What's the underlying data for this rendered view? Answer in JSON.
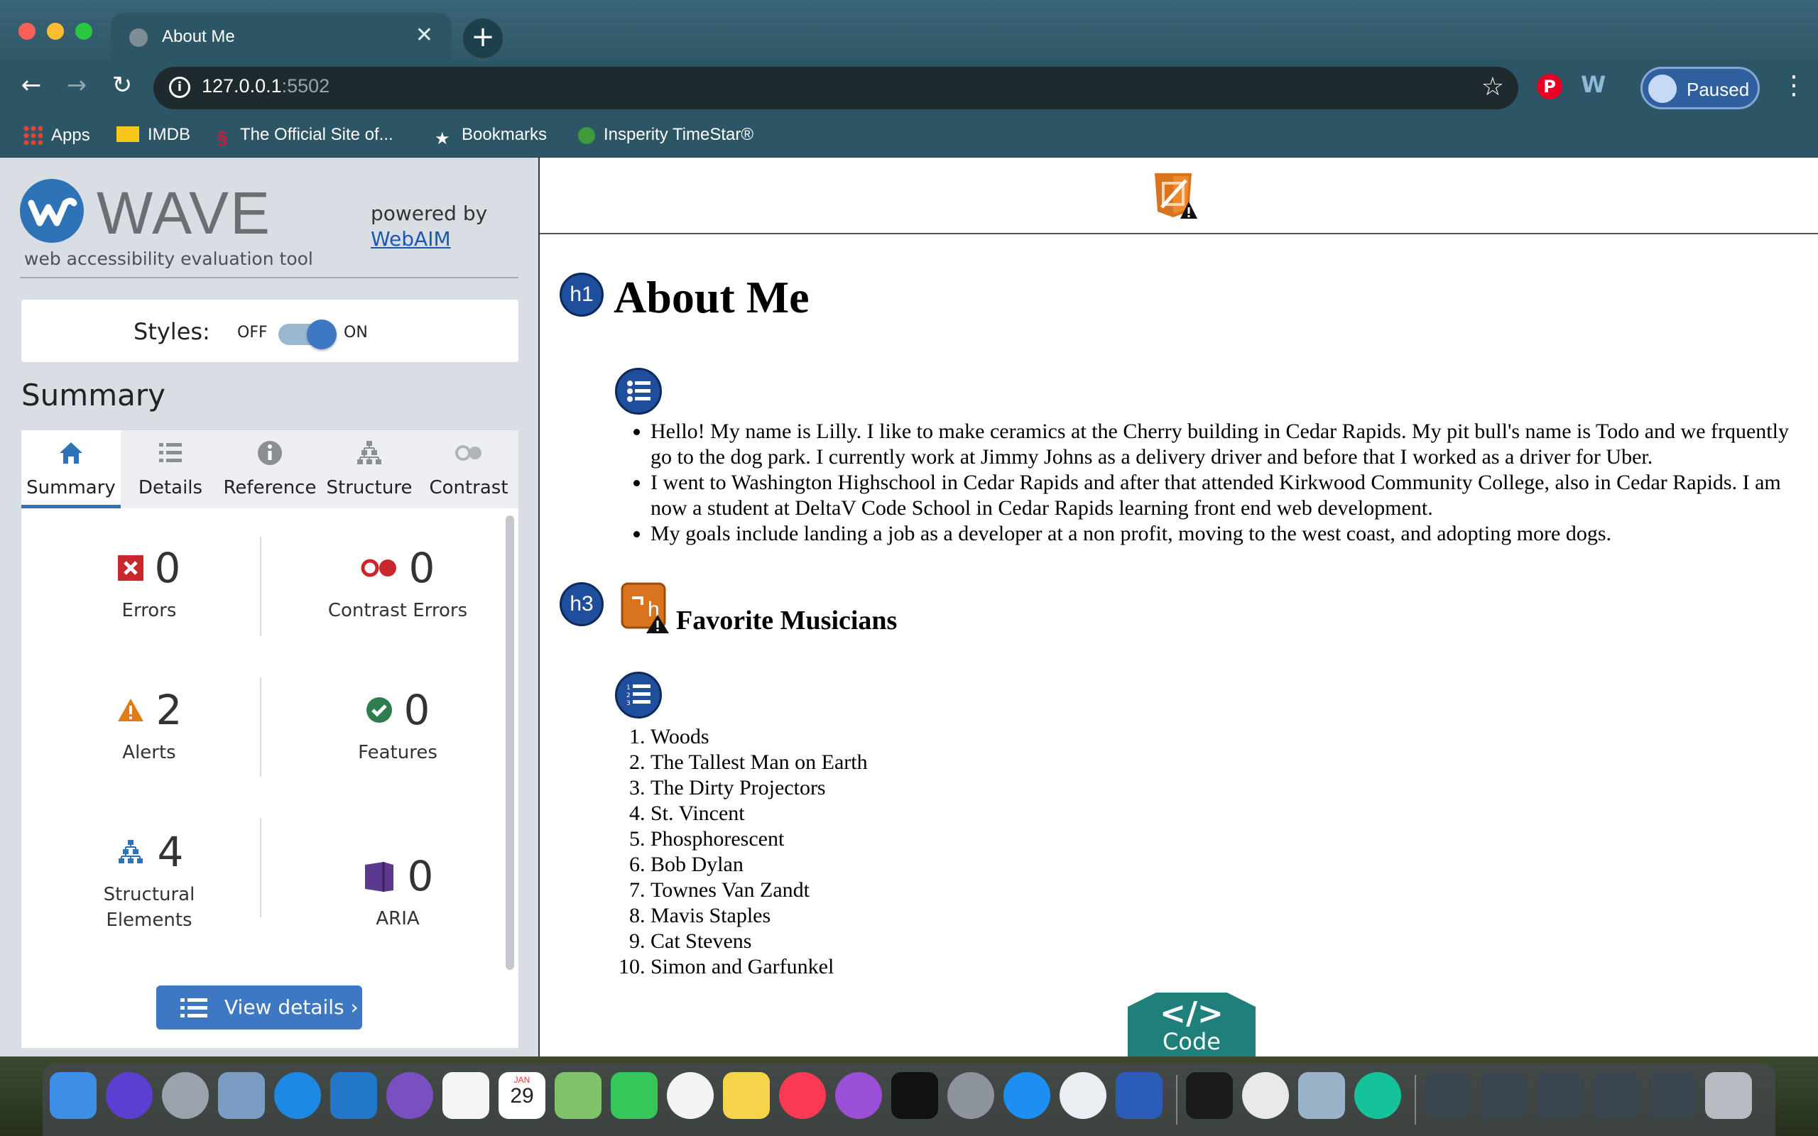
{
  "browser": {
    "tab_title": "About Me",
    "url_host": "127.0.0.1",
    "url_port": ":5502",
    "profile_label": "Paused",
    "bookmarks": [
      {
        "label": "Apps",
        "icon": "apps-grid-icon"
      },
      {
        "label": "IMDB",
        "icon": "imdb-icon"
      },
      {
        "label": "The Official Site of...",
        "icon": "cardinals-icon"
      },
      {
        "label": "Bookmarks",
        "icon": "star-icon"
      },
      {
        "label": "Insperity TimeStar®",
        "icon": "insperity-icon"
      }
    ]
  },
  "wave": {
    "logo_text": "WAVE",
    "subtitle": "web accessibility evaluation tool",
    "powered_by": "powered by",
    "webaim_link": "WebAIM",
    "styles_label": "Styles:",
    "styles_off": "OFF",
    "styles_on": "ON",
    "styles_enabled": true,
    "summary_heading": "Summary",
    "tabs": [
      {
        "label": "Summary",
        "icon": "home-icon",
        "active": true
      },
      {
        "label": "Details",
        "icon": "list-icon",
        "active": false
      },
      {
        "label": "Reference",
        "icon": "info-icon",
        "active": false
      },
      {
        "label": "Structure",
        "icon": "structure-icon",
        "active": false
      },
      {
        "label": "Contrast",
        "icon": "contrast-icon",
        "active": false
      }
    ],
    "stats": {
      "errors": {
        "count": "0",
        "label": "Errors"
      },
      "contrast_errors": {
        "count": "0",
        "label": "Contrast Errors"
      },
      "alerts": {
        "count": "2",
        "label": "Alerts"
      },
      "features": {
        "count": "0",
        "label": "Features"
      },
      "structural": {
        "count": "4",
        "label1": "Structural",
        "label2": "Elements"
      },
      "aria": {
        "count": "0",
        "label": "ARIA"
      }
    },
    "view_details": "View details ›"
  },
  "page": {
    "h1_badge": "h1",
    "h1": "About Me",
    "about_items": [
      "Hello! My name is Lilly. I like to make ceramics at the Cherry building in Cedar Rapids. My pit bull's name is Todo and we frquently go to the dog park. I currently work at Jimmy Johns as a delivery driver and before that I worked as a driver for Uber.",
      "I went to Washington Highschool in Cedar Rapids and after that attended Kirkwood Community College, also in Cedar Rapids. I am now a student at DeltaV Code School in Cedar Rapids learning front end web development.",
      "My goals include landing a job as a developer at a non profit, moving to the west coast, and adopting more dogs."
    ],
    "h3_badge": "h3",
    "h3": "Favorite Musicians",
    "musicians": [
      "Woods",
      "The Tallest Man on Earth",
      "The Dirty Projectors",
      "St. Vincent",
      "Phosphorescent",
      "Bob Dylan",
      "Townes Van Zandt",
      "Mavis Staples",
      "Cat Stevens",
      "Simon and Garfunkel"
    ],
    "code_label": "Code",
    "code_symbol": "</>"
  },
  "dock": {
    "calendar_month": "JAN",
    "calendar_day": "29",
    "apps": [
      "finder-icon",
      "siri-icon",
      "launchpad-icon",
      "preview-bird-icon",
      "safari-icon",
      "vscode-icon",
      "github-icon",
      "slack-icon",
      "calendar-icon",
      "maps-icon",
      "facetime-icon",
      "photos-icon",
      "notes-icon",
      "music-icon",
      "podcasts-icon",
      "appletv-icon",
      "system-preferences-icon",
      "app-store-icon",
      "weather-icon",
      "word-icon",
      "terminal-icon",
      "chrome-icon",
      "image-capture-icon",
      "grammarly-icon",
      "window-thumb-icon",
      "window-thumb-icon",
      "window-thumb-icon",
      "window-thumb-icon",
      "window-thumb-icon",
      "trash-icon"
    ]
  },
  "colors": {
    "wave_blue": "#2e72b8",
    "error_red": "#c8272d",
    "alert_orange": "#e07b18",
    "feature_green": "#2f7d4f",
    "aria_purple": "#5b3a8e",
    "badge_blue": "#1f4f9c",
    "code_teal": "#1f7f7a"
  }
}
